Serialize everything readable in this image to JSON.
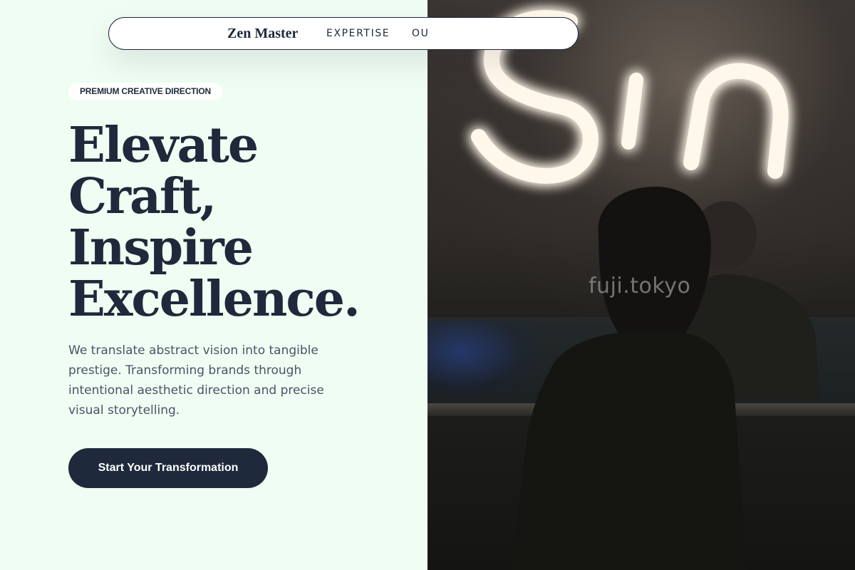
{
  "nav": {
    "brand": "Zen Master",
    "links": [
      {
        "label": "EXPERTISE"
      },
      {
        "label": "OU"
      }
    ]
  },
  "hero": {
    "eyebrow": "PREMIUM CREATIVE DIRECTION",
    "headline_lines": [
      "Elevate",
      "Craft,",
      "Inspire",
      "Excellence."
    ],
    "description": "We translate abstract vision into tangible prestige. Transforming brands through intentional aesthetic direction and precise visual storytelling.",
    "cta_label": "Start Your Transformation"
  },
  "photo": {
    "neon_sign": "Sin",
    "watermark": "fuji.tokyo"
  },
  "colors": {
    "background": "#effdf2",
    "ink": "#1e293b",
    "muted_text": "#475569",
    "neon": "#fff7ea"
  }
}
